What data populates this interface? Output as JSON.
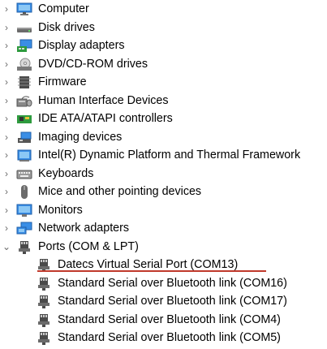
{
  "categories": [
    {
      "label": "Computer",
      "icon": "computer-icon",
      "expanded": false
    },
    {
      "label": "Disk drives",
      "icon": "disk-drive-icon",
      "expanded": false
    },
    {
      "label": "Display adapters",
      "icon": "display-adapter-icon",
      "expanded": false
    },
    {
      "label": "DVD/CD-ROM drives",
      "icon": "dvd-drive-icon",
      "expanded": false
    },
    {
      "label": "Firmware",
      "icon": "firmware-icon",
      "expanded": false
    },
    {
      "label": "Human Interface Devices",
      "icon": "hid-icon",
      "expanded": false
    },
    {
      "label": "IDE ATA/ATAPI controllers",
      "icon": "ide-controller-icon",
      "expanded": false
    },
    {
      "label": "Imaging devices",
      "icon": "imaging-device-icon",
      "expanded": false
    },
    {
      "label": "Intel(R) Dynamic Platform and Thermal Framework",
      "icon": "thermal-framework-icon",
      "expanded": false
    },
    {
      "label": "Keyboards",
      "icon": "keyboard-icon",
      "expanded": false
    },
    {
      "label": "Mice and other pointing devices",
      "icon": "mouse-icon",
      "expanded": false
    },
    {
      "label": "Monitors",
      "icon": "monitor-icon",
      "expanded": false
    },
    {
      "label": "Network adapters",
      "icon": "network-adapter-icon",
      "expanded": false
    },
    {
      "label": "Ports (COM & LPT)",
      "icon": "port-icon",
      "expanded": true
    }
  ],
  "ports": [
    {
      "label": "Datecs Virtual Serial Port (COM13)",
      "icon": "port-icon",
      "highlighted": true
    },
    {
      "label": "Standard Serial over Bluetooth link (COM16)",
      "icon": "port-icon"
    },
    {
      "label": "Standard Serial over Bluetooth link (COM17)",
      "icon": "port-icon"
    },
    {
      "label": "Standard Serial over Bluetooth link (COM4)",
      "icon": "port-icon"
    },
    {
      "label": "Standard Serial over Bluetooth link (COM5)",
      "icon": "port-icon"
    }
  ],
  "colors": {
    "highlight_underline": "#c0392b",
    "chevron": "#6b6b6b"
  }
}
